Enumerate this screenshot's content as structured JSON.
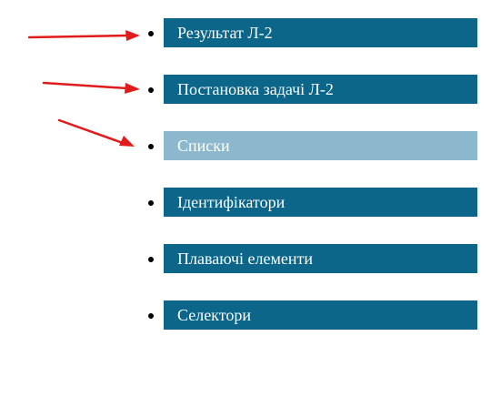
{
  "nav": {
    "items": [
      {
        "label": "Результат Л-2",
        "state": "normal"
      },
      {
        "label": "Постановка задачі Л-2",
        "state": "normal"
      },
      {
        "label": "Списки",
        "state": "active"
      },
      {
        "label": "Ідентифікатори",
        "state": "normal"
      },
      {
        "label": "Плаваючі елементи",
        "state": "normal"
      },
      {
        "label": "Селектори",
        "state": "normal"
      }
    ]
  },
  "colors": {
    "item_bg": "#0b6689",
    "item_bg_active": "#8bb8cc",
    "item_text": "#ffffff",
    "bullet": "#000000",
    "arrow": "#e01b1b"
  }
}
